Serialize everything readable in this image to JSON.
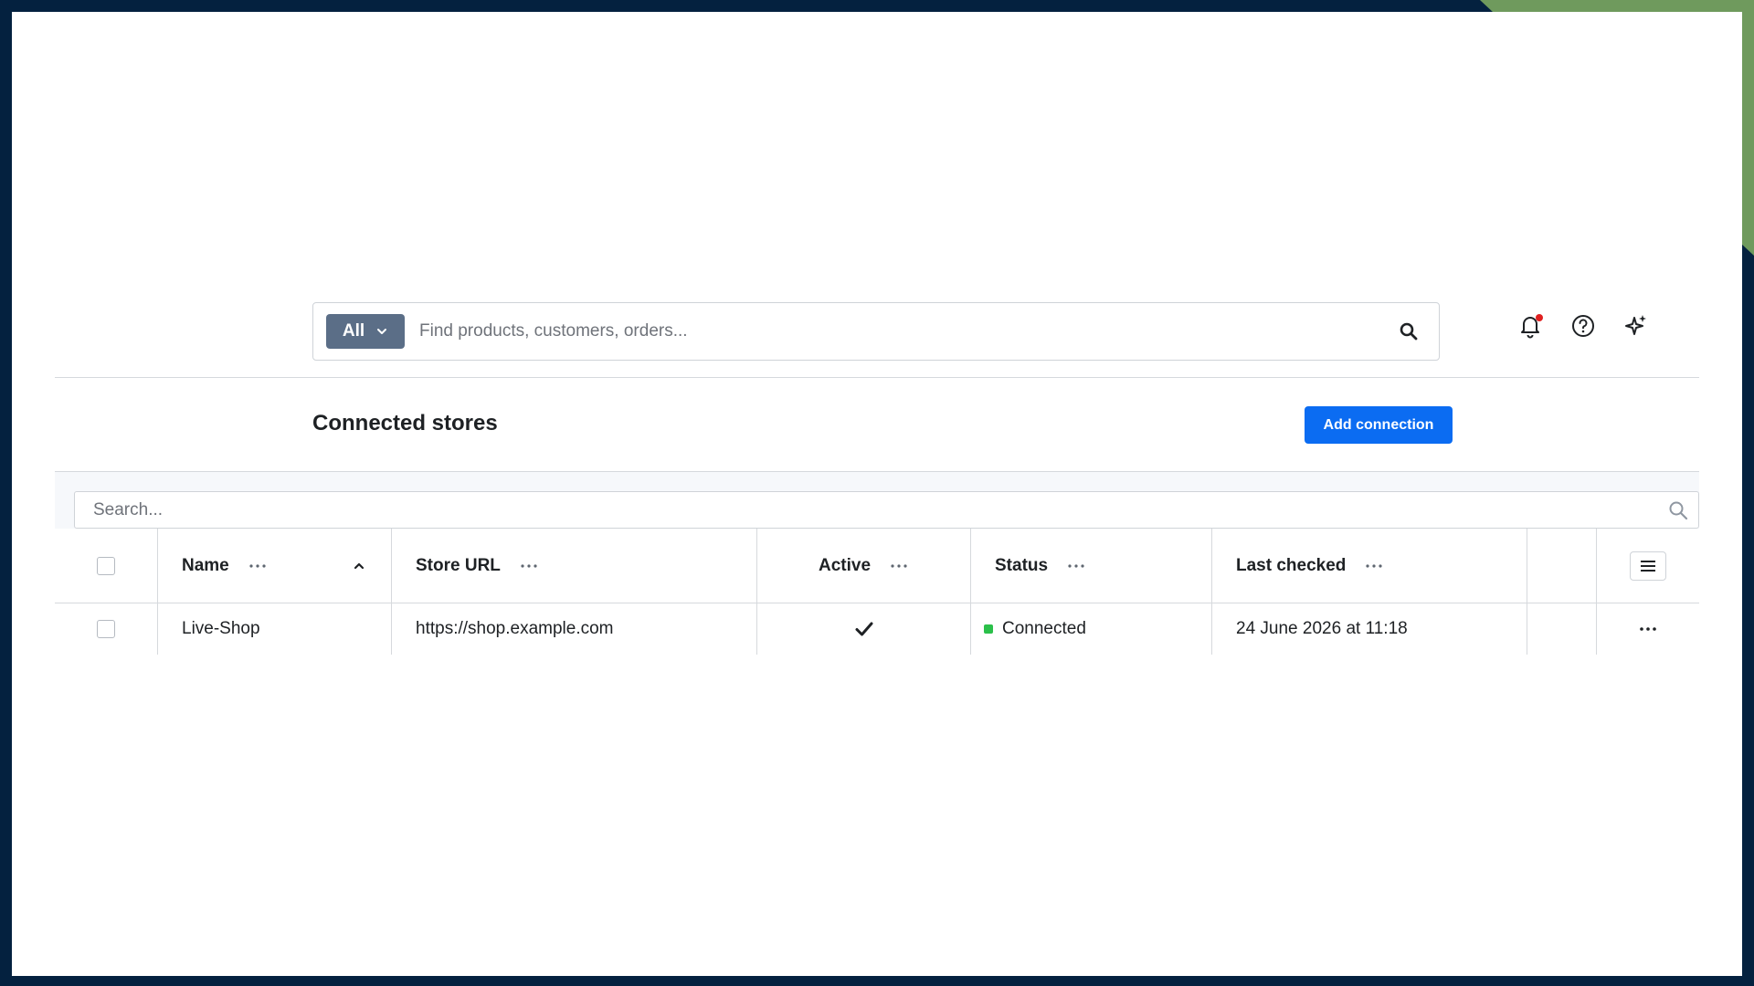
{
  "colors": {
    "background": "#04213f",
    "accent_corner": "#6f9a5d",
    "primary_button": "#0b6cf2",
    "scope_select": "#5b6e87",
    "status_connected": "#2bc04a",
    "notification_dot": "#e02020"
  },
  "top_bar": {
    "scope_select": {
      "value": "All",
      "icon": "chevron-down-icon"
    },
    "search": {
      "placeholder": "Find products, customers, orders...",
      "icon": "search-icon"
    },
    "icons": [
      "bell-icon",
      "help-icon",
      "sparkle-icon"
    ]
  },
  "page_header": {
    "title": "Connected stores",
    "add_button_label": "Add connection"
  },
  "grid": {
    "search": {
      "placeholder": "Search...",
      "icon": "search-icon"
    },
    "columns": [
      {
        "label": "Name",
        "sort": "ascending"
      },
      {
        "label": "Store URL"
      },
      {
        "label": "Active"
      },
      {
        "label": "Status"
      },
      {
        "label": "Last checked"
      }
    ],
    "rows": [
      {
        "name": "Live-Shop",
        "store_url": "https://shop.example.com",
        "active": true,
        "status": "Connected",
        "last_checked": "24 June 2026 at 11:18"
      }
    ]
  }
}
